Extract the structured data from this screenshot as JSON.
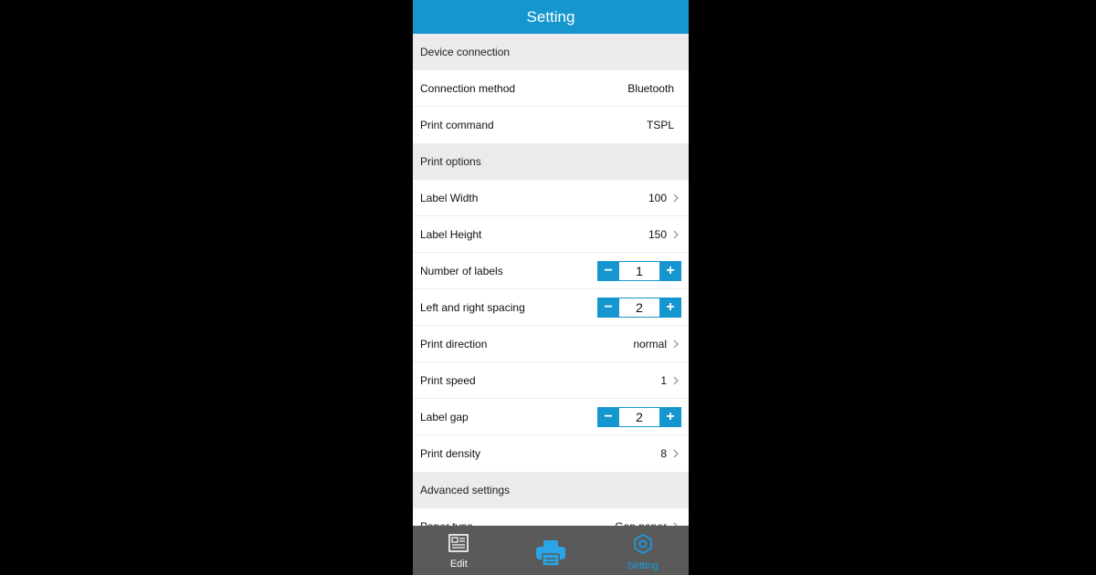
{
  "title": "Setting",
  "sections": [
    {
      "header": "Device connection",
      "rows": [
        {
          "label": "Connection method",
          "value": "Bluetooth",
          "kind": "text"
        },
        {
          "label": "Print command",
          "value": "TSPL",
          "kind": "text"
        }
      ]
    },
    {
      "header": "Print options",
      "rows": [
        {
          "label": "Label Width",
          "value": "100",
          "kind": "nav"
        },
        {
          "label": "Label Height",
          "value": "150",
          "kind": "nav"
        },
        {
          "label": "Number of labels",
          "value": "1",
          "kind": "stepper"
        },
        {
          "label": "Left and right spacing",
          "value": "2",
          "kind": "stepper"
        },
        {
          "label": "Print direction",
          "value": "normal",
          "kind": "nav"
        },
        {
          "label": "Print speed",
          "value": "1",
          "kind": "nav"
        },
        {
          "label": "Label gap",
          "value": "2",
          "kind": "stepper"
        },
        {
          "label": "Print density",
          "value": "8",
          "kind": "nav"
        }
      ]
    },
    {
      "header": "Advanced settings",
      "rows": [
        {
          "label": "Paper type",
          "value": "Gap paper",
          "kind": "nav"
        }
      ]
    }
  ],
  "stepper_minus": "−",
  "stepper_plus": "+",
  "tabs": [
    {
      "label": "Edit",
      "icon": "edit-icon",
      "active": false
    },
    {
      "label": "",
      "icon": "printer-icon",
      "active": false
    },
    {
      "label": "Setting",
      "icon": "settings-icon",
      "active": true
    }
  ],
  "colors": {
    "accent": "#1596cf",
    "section_bg": "#ebebeb",
    "tabbar_bg": "#5a5a5a",
    "active_tab": "#1a9be0"
  }
}
